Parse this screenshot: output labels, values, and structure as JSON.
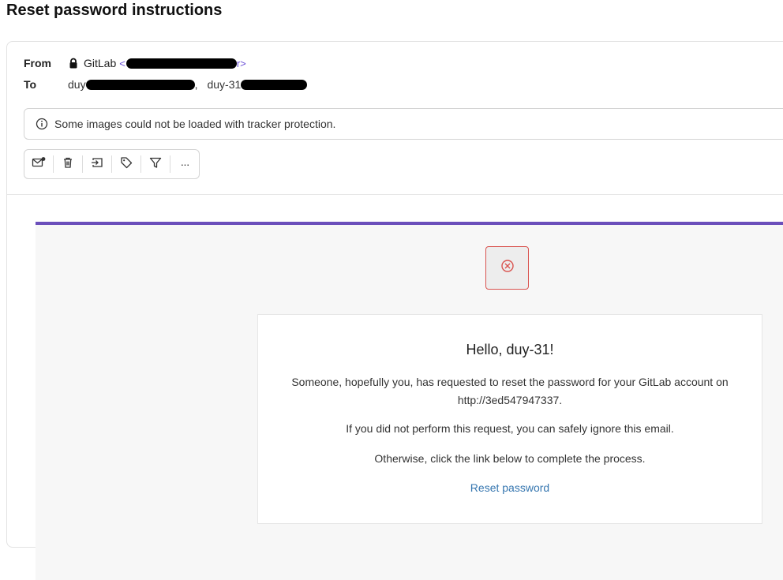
{
  "subject": "Reset password instructions",
  "header": {
    "from_label": "From",
    "sender_name": "GitLab",
    "sender_addr_prefix": "<",
    "sender_addr_suffix": "r>",
    "to_label": "To",
    "to_first": "duy",
    "to_sep": ",",
    "to_second": "duy-31"
  },
  "notice": {
    "text": "Some images could not be loaded with tracker protection."
  },
  "toolbar": {
    "buttons": [
      "mark-unread-icon",
      "trash-icon",
      "move-icon",
      "label-icon",
      "filter-icon",
      "more-icon"
    ],
    "more_label": "···"
  },
  "email": {
    "greeting": "Hello, duy-31!",
    "paragraph1": "Someone, hopefully you, has requested to reset the password for your GitLab account on http://3ed547947337.",
    "paragraph2": "If you did not perform this request, you can safely ignore this email.",
    "paragraph3": "Otherwise, click the link below to complete the process.",
    "link_label": "Reset password"
  },
  "colors": {
    "accent": "#6b4fbb",
    "link": "#3777b0",
    "sender_addr": "#6a4fd6",
    "logo_border": "#d9534f"
  }
}
